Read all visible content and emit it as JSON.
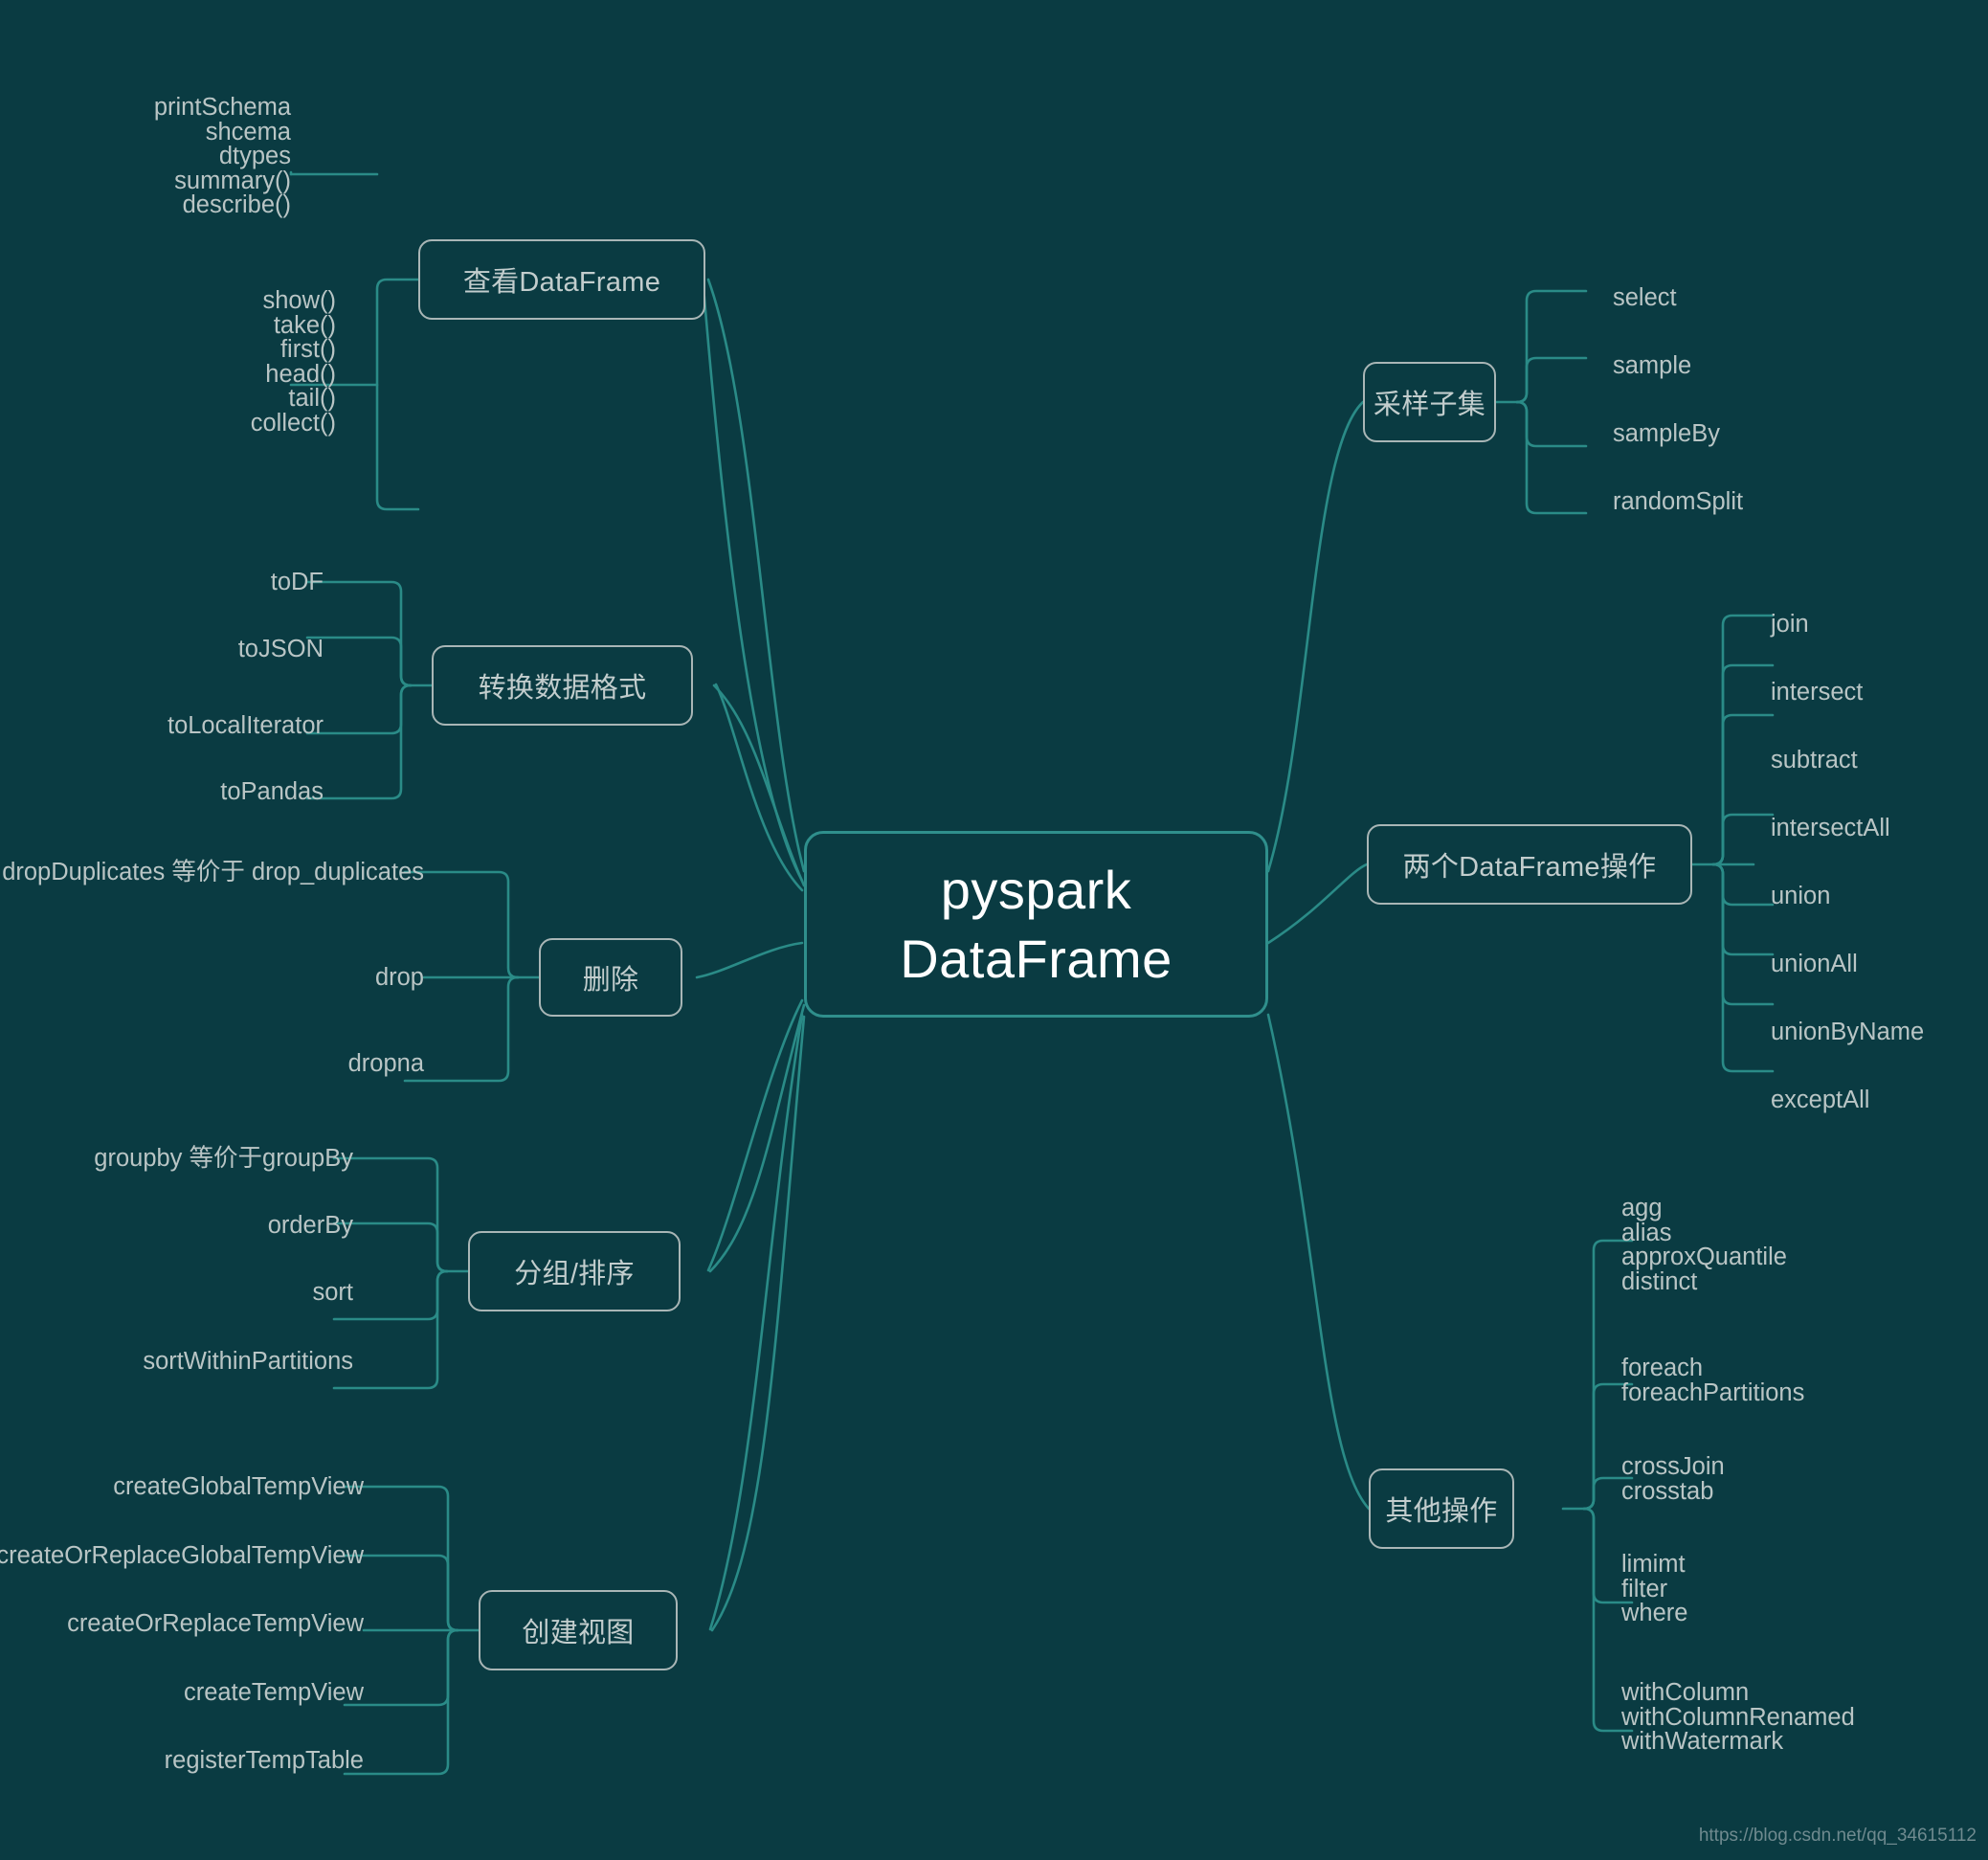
{
  "meta": {
    "bg_color": "#0a3b42",
    "accent_color": "#2f8f8c",
    "node_border_color": "#a9b6b6",
    "text_color": "#b9c5c5",
    "center_text_color": "#ffffff",
    "watermark": "https://blog.csdn.net/qq_34615112"
  },
  "center": {
    "line1": "pyspark",
    "line2": "DataFrame"
  },
  "branches": [
    {
      "id": "view-dataframe",
      "label": "查看DataFrame",
      "side": "left",
      "groups": [
        {
          "items": [
            "printSchema",
            "shcema",
            "dtypes",
            "summary()",
            "describe()"
          ]
        },
        {
          "items": [
            "show()",
            "take()",
            "first()",
            "head()",
            "tail()",
            "collect()"
          ]
        }
      ]
    },
    {
      "id": "convert-format",
      "label": "转换数据格式",
      "side": "left",
      "groups": [
        {
          "items": [
            "toDF"
          ]
        },
        {
          "items": [
            "toJSON"
          ]
        },
        {
          "items": [
            "toLocalIterator"
          ]
        },
        {
          "items": [
            "toPandas"
          ]
        }
      ]
    },
    {
      "id": "delete",
      "label": "删除",
      "side": "left",
      "groups": [
        {
          "items": [
            "dropDuplicates 等价于 drop_duplicates"
          ]
        },
        {
          "items": [
            "drop"
          ]
        },
        {
          "items": [
            "dropna"
          ]
        }
      ]
    },
    {
      "id": "group-sort",
      "label": "分组/排序",
      "side": "left",
      "groups": [
        {
          "items": [
            "groupby 等价于groupBy"
          ]
        },
        {
          "items": [
            "orderBy"
          ]
        },
        {
          "items": [
            "sort"
          ]
        },
        {
          "items": [
            "sortWithinPartitions"
          ]
        }
      ]
    },
    {
      "id": "create-view",
      "label": "创建视图",
      "side": "left",
      "groups": [
        {
          "items": [
            "createGlobalTempView"
          ]
        },
        {
          "items": [
            "createOrReplaceGlobalTempView"
          ]
        },
        {
          "items": [
            "createOrReplaceTempView"
          ]
        },
        {
          "items": [
            "createTempView"
          ]
        },
        {
          "items": [
            "registerTempTable"
          ]
        }
      ]
    },
    {
      "id": "sample-subset",
      "label": "采样子集",
      "side": "right",
      "groups": [
        {
          "items": [
            "select"
          ]
        },
        {
          "items": [
            "sample"
          ]
        },
        {
          "items": [
            "sampleBy"
          ]
        },
        {
          "items": [
            "randomSplit"
          ]
        }
      ]
    },
    {
      "id": "two-dataframe-ops",
      "label": "两个DataFrame操作",
      "side": "right",
      "groups": [
        {
          "items": [
            "join"
          ]
        },
        {
          "items": [
            "intersect"
          ]
        },
        {
          "items": [
            "subtract"
          ]
        },
        {
          "items": [
            "intersectAll"
          ]
        },
        {
          "items": [
            "union"
          ]
        },
        {
          "items": [
            "unionAll"
          ]
        },
        {
          "items": [
            "unionByName"
          ]
        },
        {
          "items": [
            "exceptAll"
          ]
        }
      ]
    },
    {
      "id": "other-ops",
      "label": "其他操作",
      "side": "right",
      "groups": [
        {
          "items": [
            "agg",
            "alias",
            "approxQuantile",
            "distinct"
          ]
        },
        {
          "items": [
            "foreach",
            "foreachPartitions"
          ]
        },
        {
          "items": [
            "crossJoin",
            "crosstab"
          ]
        },
        {
          "items": [
            "limimt",
            "filter",
            "where"
          ]
        },
        {
          "items": [
            "withColumn",
            "withColumnRenamed",
            "withWatermark"
          ]
        }
      ]
    }
  ]
}
